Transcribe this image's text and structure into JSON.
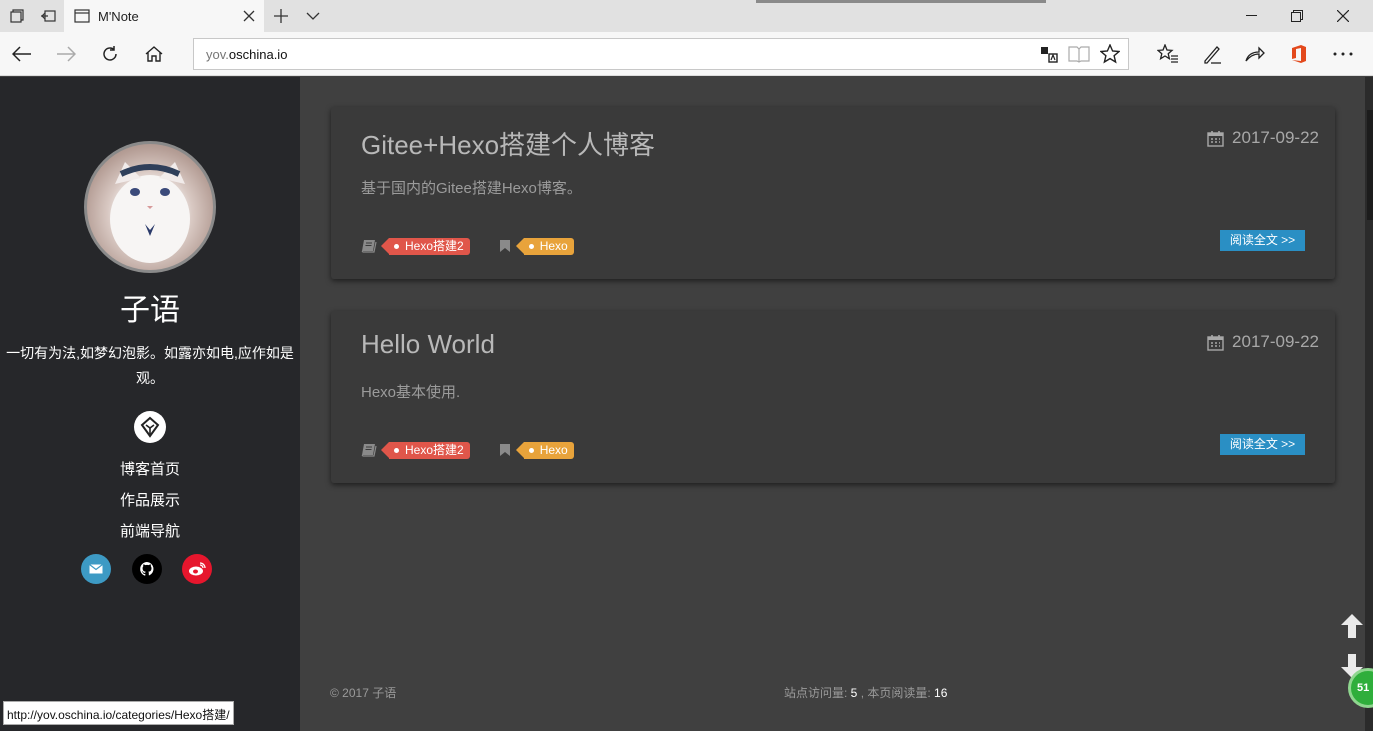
{
  "browser": {
    "tab_title": "M'Note",
    "url_host_grey": "yov.",
    "url_host_dark": "oschina.io",
    "status_url": "http://yov.oschina.io/categories/Hexo搭建/"
  },
  "sidebar": {
    "site_name": "子语",
    "motto": "一切有为法,如梦幻泡影。如露亦如电,应作如是观。",
    "menu": [
      "博客首页",
      "作品展示",
      "前端导航"
    ],
    "social": [
      {
        "icon": "mail-icon",
        "color": "#3d9ac4"
      },
      {
        "icon": "github-icon",
        "color": "#000000"
      },
      {
        "icon": "weibo-icon",
        "color": "#e6162d"
      }
    ]
  },
  "posts": [
    {
      "title": "Gitee+Hexo搭建个人博客",
      "date": "2017-09-22",
      "desc": "基于国内的Gitee搭建Hexo博客。",
      "category": "Hexo搭建2",
      "tag": "Hexo",
      "read_more": "阅读全文 >>"
    },
    {
      "title": "Hello World",
      "date": "2017-09-22",
      "desc": "Hexo基本使用.",
      "category": "Hexo搭建2",
      "tag": "Hexo",
      "read_more": "阅读全文 >>"
    }
  ],
  "footer": {
    "copyright": "© 2017 子语",
    "site_visits_label": "站点访问量: ",
    "site_visits": "5",
    "page_views_label": " , 本页阅读量: ",
    "page_views": "16"
  },
  "badge": "51",
  "colors": {
    "tag_category": "#e0564a",
    "tag_tag": "#e8a33b",
    "read_button": "#2a8fc4",
    "sidebar_bg": "#26272a",
    "main_bg": "#404040"
  }
}
